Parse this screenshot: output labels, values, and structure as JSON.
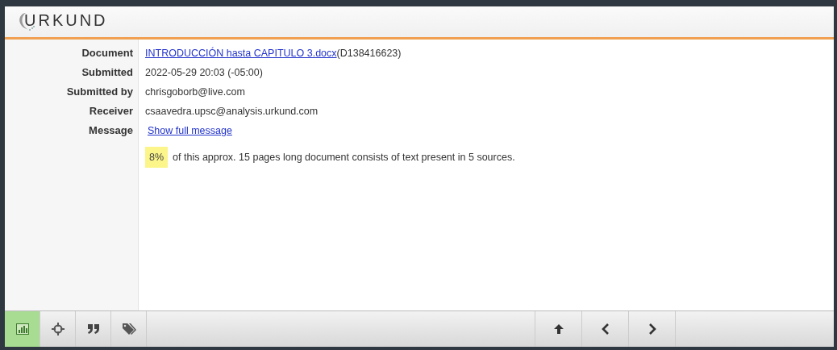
{
  "logo": {
    "text": "URKUND"
  },
  "details": [
    {
      "label": "Document",
      "kind": "document",
      "link": "INTRODUCCIÓN hasta CAPITULO 3.docx",
      "value": "(D138416623)"
    },
    {
      "label": "Submitted",
      "kind": "text",
      "value": "2022-05-29 20:03 (-05:00)"
    },
    {
      "label": "Submitted by",
      "kind": "text",
      "value": "chrisgoborb@live.com"
    },
    {
      "label": "Receiver",
      "kind": "text",
      "value": "csaavedra.upsc@analysis.urkund.com"
    },
    {
      "label": "Message",
      "kind": "link",
      "link": "Show full message"
    }
  ],
  "summary": {
    "percent": "8%",
    "text": "of this approx. 15 pages long document consists of text present in 5 sources."
  },
  "tools": [
    {
      "kind": "chart",
      "selected": true
    },
    {
      "kind": "target",
      "selected": false
    },
    {
      "kind": "quote",
      "selected": false
    },
    {
      "kind": "tag",
      "selected": false
    }
  ],
  "navigation": [
    {
      "kind": "up"
    },
    {
      "kind": "prev"
    },
    {
      "kind": "next"
    }
  ]
}
